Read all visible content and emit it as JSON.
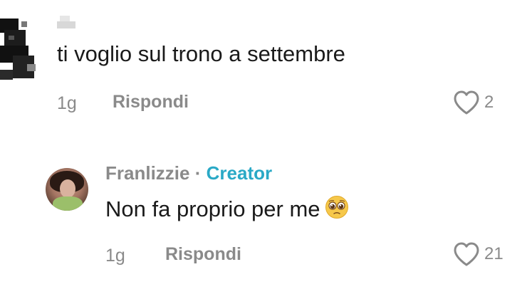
{
  "comment": {
    "text": "ti voglio sul trono a settembre",
    "time": "1g",
    "reply_label": "Rispondi",
    "like_count": "2"
  },
  "reply": {
    "username": "Franlizzie",
    "separator": "·",
    "badge": "Creator",
    "text": "Non fa proprio per me",
    "emoji": "pleading-face-emoji",
    "time": "1g",
    "reply_label": "Rispondi",
    "like_count": "21"
  },
  "colors": {
    "text": "#1a1a1a",
    "muted": "#8a8a8a",
    "creator": "#2aa9c6",
    "background": "#ffffff"
  }
}
